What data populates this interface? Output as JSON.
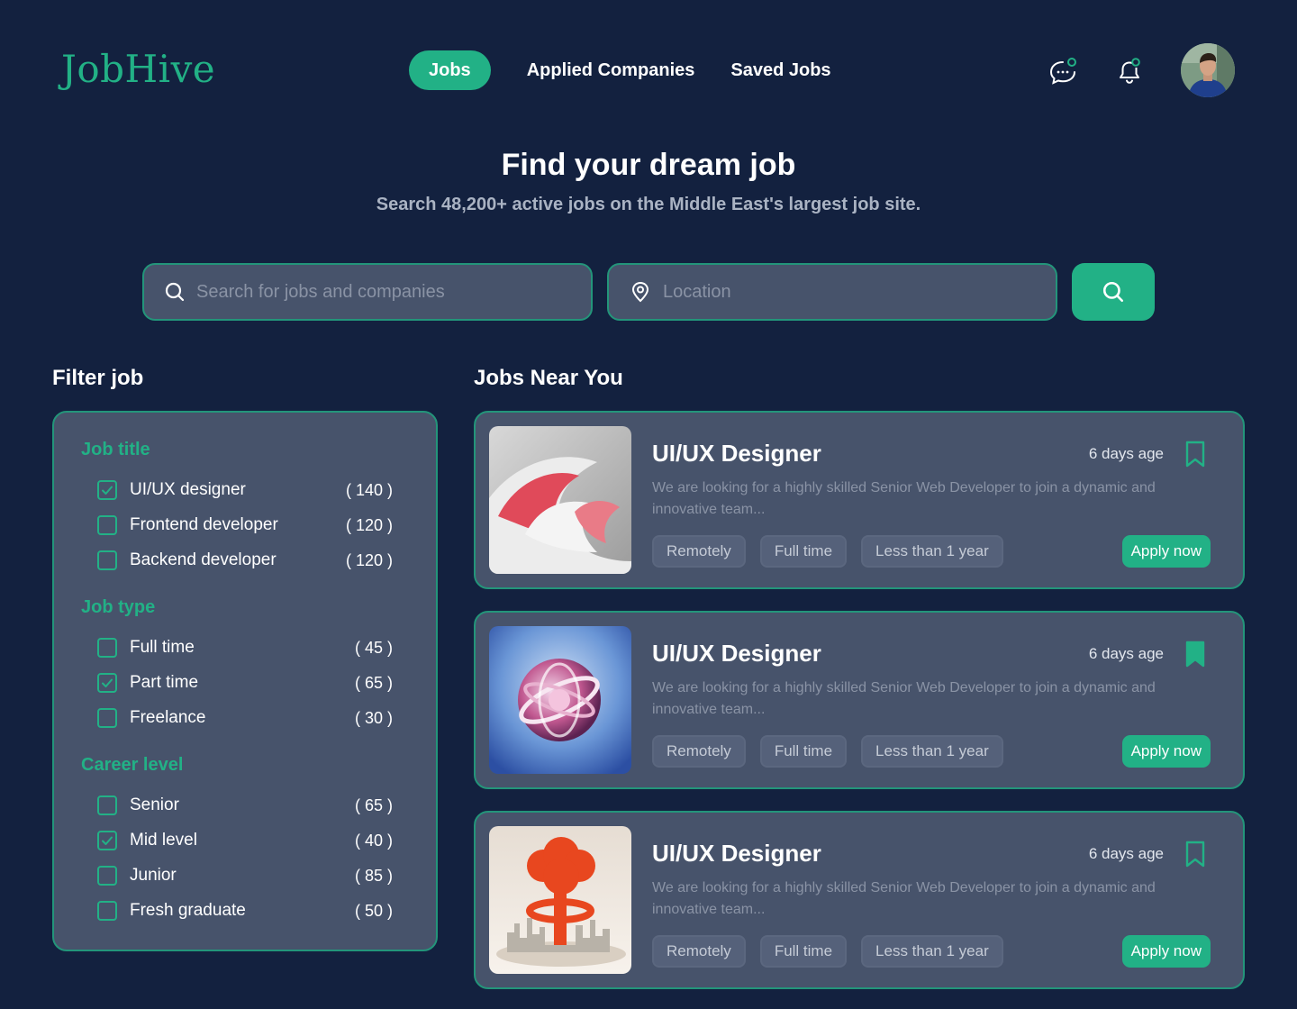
{
  "brand": {
    "name": "JobHive",
    "accent": "#22b186",
    "background": "#13213f",
    "panel": "#47536b"
  },
  "nav": {
    "items": [
      {
        "label": "Jobs",
        "active": true
      },
      {
        "label": "Applied Companies",
        "active": false
      },
      {
        "label": "Saved Jobs",
        "active": false
      }
    ],
    "icons": [
      "chat-icon",
      "bell-icon"
    ]
  },
  "hero": {
    "title": "Find your dream job",
    "subtitle": "Search 48,200+ active jobs on the Middle East's largest job site."
  },
  "search": {
    "query_placeholder": "Search for jobs and companies",
    "location_placeholder": "Location",
    "query_icon": "search-icon",
    "location_icon": "location-pin-icon",
    "button_icon": "search-icon"
  },
  "filter": {
    "title": "Filter job",
    "groups": [
      {
        "title": "Job title",
        "options": [
          {
            "label": "UI/UX designer",
            "count": "( 140 )",
            "checked": true
          },
          {
            "label": "Frontend developer",
            "count": "( 120 )",
            "checked": false
          },
          {
            "label": "Backend developer",
            "count": "( 120 )",
            "checked": false
          }
        ]
      },
      {
        "title": "Job type",
        "options": [
          {
            "label": "Full time",
            "count": "( 45 )",
            "checked": false
          },
          {
            "label": "Part time",
            "count": "( 65 )",
            "checked": true
          },
          {
            "label": "Freelance",
            "count": "( 30 )",
            "checked": false
          }
        ]
      },
      {
        "title": "Career level",
        "options": [
          {
            "label": "Senior",
            "count": "( 65 )",
            "checked": false
          },
          {
            "label": "Mid level",
            "count": "( 40 )",
            "checked": true
          },
          {
            "label": "Junior",
            "count": "( 85 )",
            "checked": false
          },
          {
            "label": "Fresh graduate",
            "count": "( 50 )",
            "checked": false
          }
        ]
      }
    ]
  },
  "jobs": {
    "title": "Jobs Near You",
    "items": [
      {
        "title": "UI/UX Designer",
        "age": "6 days age",
        "saved": false,
        "description": "We are looking for a highly skilled Senior Web Developer to join a dynamic and innovative team...",
        "tags": [
          "Remotely",
          "Full time",
          "Less than 1 year"
        ],
        "apply_label": "Apply now"
      },
      {
        "title": "UI/UX Designer",
        "age": "6 days age",
        "saved": true,
        "description": "We are looking for a highly skilled Senior Web Developer to join a dynamic and innovative team...",
        "tags": [
          "Remotely",
          "Full time",
          "Less than 1 year"
        ],
        "apply_label": "Apply now"
      },
      {
        "title": "UI/UX Designer",
        "age": "6 days age",
        "saved": false,
        "description": "We are looking for a highly skilled Senior Web Developer to join a dynamic and innovative team...",
        "tags": [
          "Remotely",
          "Full time",
          "Less than 1 year"
        ],
        "apply_label": "Apply now"
      }
    ]
  }
}
